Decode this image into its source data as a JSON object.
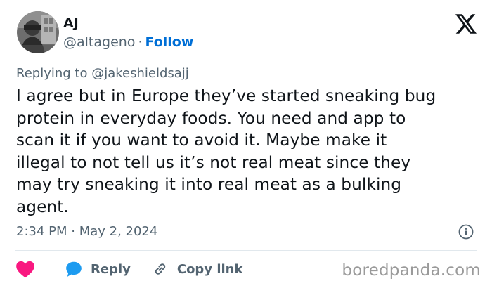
{
  "user": {
    "name": "AJ",
    "handle": "@altageno",
    "separator": "·",
    "follow_label": "Follow"
  },
  "reply_context": {
    "prefix": "Replying to",
    "mention": "@jakeshieldsajj"
  },
  "tweet": {
    "lines": [
      "I agree but in Europe they’ve started sneaking bug",
      "protein in everyday foods. You need and app to",
      "scan it if you want to avoid it. Maybe make it",
      "illegal to not tell us it’s not real meat since they",
      "may try sneaking it into real meat as a bulking",
      "agent."
    ],
    "timestamp": "2:34 PM · May 2, 2024"
  },
  "actions": {
    "reply_label": "Reply",
    "copy_link_label": "Copy link"
  },
  "watermark": "boredpanda.com",
  "icons": {
    "brand": "x-logo-icon",
    "like": "heart-icon",
    "reply": "speech-bubble-icon",
    "copy": "link-icon",
    "info": "info-icon"
  },
  "colors": {
    "text": "#0f1419",
    "secondary": "#536471",
    "link": "#006fd6",
    "heart": "#f91880",
    "reply_bubble": "#1d9bf0"
  }
}
